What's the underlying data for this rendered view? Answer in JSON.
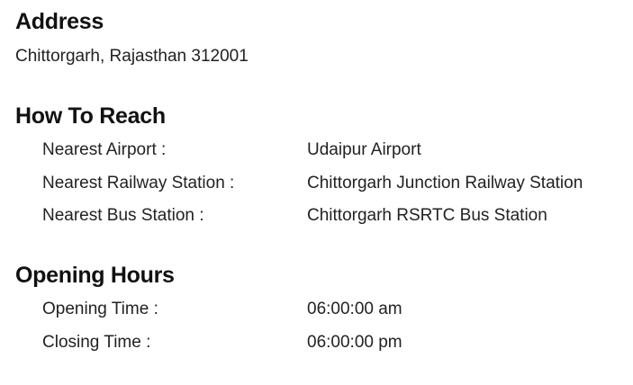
{
  "address": {
    "title": "Address",
    "text": "Chittorgarh, Rajasthan 312001"
  },
  "how_to_reach": {
    "title": "How To Reach",
    "rows": [
      {
        "label": "Nearest Airport :",
        "value": "Udaipur Airport"
      },
      {
        "label": "Nearest Railway Station :",
        "value": "Chittorgarh Junction Railway Station"
      },
      {
        "label": "Nearest Bus Station :",
        "value": "Chittorgarh RSRTC Bus Station"
      }
    ]
  },
  "opening_hours": {
    "title": "Opening Hours",
    "rows": [
      {
        "label": "Opening Time :",
        "value": "06:00:00 am"
      },
      {
        "label": "Closing Time :",
        "value": "06:00:00 pm"
      }
    ]
  }
}
